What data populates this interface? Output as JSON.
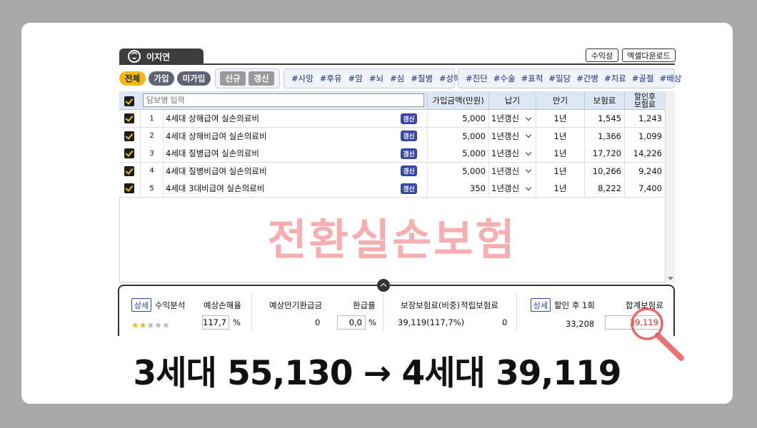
{
  "user": {
    "name": "이지연"
  },
  "toolbar": {
    "profit_label": "수익성",
    "excel_label": "엑셀다운로드"
  },
  "filters": {
    "status": [
      "전체",
      "가입",
      "미가입"
    ],
    "type": [
      "신규",
      "갱신"
    ],
    "tags_1": [
      "#사망",
      "#후유",
      "#암",
      "#뇌",
      "#심",
      "#질병",
      "#상해"
    ],
    "tags_2": [
      "#진단",
      "#수술",
      "#표적",
      "#일당",
      "#간병",
      "#치료",
      "#골절",
      "#배상"
    ]
  },
  "table": {
    "search_placeholder": "담보명 입력",
    "headers": {
      "amount": "가입금액(만원)",
      "payment": "납기",
      "maturity": "만기",
      "premium": "보험료",
      "discount_line1": "할인후",
      "discount_line2": "보험료"
    },
    "rows": [
      {
        "no": "1",
        "name": "4세대 상해급여 실손의료비",
        "badge": "갱신",
        "amount": "5,000",
        "payment": "1년갱신",
        "maturity": "1년",
        "premium": "1,545",
        "discounted": "1,243"
      },
      {
        "no": "2",
        "name": "4세대 상해비급여 실손의료비",
        "badge": "갱신",
        "amount": "5,000",
        "payment": "1년갱신",
        "maturity": "1년",
        "premium": "1,366",
        "discounted": "1,099"
      },
      {
        "no": "3",
        "name": "4세대 질병급여 실손의료비",
        "badge": "갱신",
        "amount": "5,000",
        "payment": "1년갱신",
        "maturity": "1년",
        "premium": "17,720",
        "discounted": "14,226"
      },
      {
        "no": "4",
        "name": "4세대 질병비급여 실손의료비",
        "badge": "갱신",
        "amount": "5,000",
        "payment": "1년갱신",
        "maturity": "1년",
        "premium": "10,266",
        "discounted": "9,240"
      },
      {
        "no": "5",
        "name": "4세대 3대비급여 실손의료비",
        "badge": "갱신",
        "amount": "350",
        "payment": "1년갱신",
        "maturity": "1년",
        "premium": "8,222",
        "discounted": "7,400"
      }
    ]
  },
  "watermark": "전환실손보험",
  "summary": {
    "detail_label": "상세",
    "profit_analysis": "수익분석",
    "stars_filled": 2,
    "stars_total": 5,
    "expected_loss_label": "예상손해율",
    "expected_loss_value": "117,7",
    "percent": "%",
    "maturity_refund_label": "예상만기환급금",
    "maturity_refund_value": "0",
    "refund_rate_label": "환급률",
    "refund_rate_value": "0,0",
    "guarantee_label": "보장보험료(비중)",
    "guarantee_value": "39,119(117,7%)",
    "accumulated_label": "적립보험료",
    "accumulated_value": "0",
    "after_discount_label": "할인 후 1회",
    "after_discount_value": "33,208",
    "total_label": "합계보험료",
    "total_value": "39,119"
  },
  "caption": "3세대 55,130 → 4세대 39,119",
  "colors": {
    "accent_yellow": "#f2b915",
    "navy": "#3545a8",
    "watermark": "#f7aeb0",
    "highlight": "#e85a5a"
  }
}
